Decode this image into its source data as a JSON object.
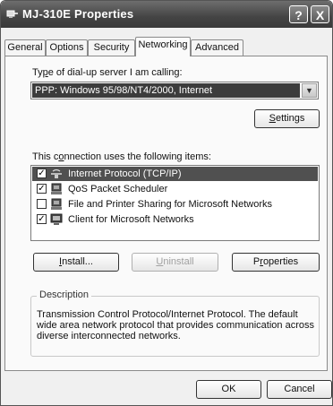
{
  "window": {
    "title": "MJ-310E Properties",
    "help_button": "?",
    "close_button": "X"
  },
  "tabs": [
    {
      "label": "General"
    },
    {
      "label": "Options"
    },
    {
      "label": "Security"
    },
    {
      "label": "Networking",
      "active": true
    },
    {
      "label": "Advanced"
    }
  ],
  "server": {
    "label_prefix": "Ty",
    "label_u": "p",
    "label_rest": "e of dial-up server I am calling:",
    "value": "PPP: Windows 95/98/NT4/2000, Internet"
  },
  "settings_button": {
    "u": "S",
    "rest": "ettings"
  },
  "items_label": {
    "prefix": "This c",
    "u": "o",
    "rest": "nnection uses the following items:"
  },
  "items": [
    {
      "label": "Internet Protocol (TCP/IP)",
      "checked": true,
      "selected": true,
      "icon": "network-protocol-icon"
    },
    {
      "label": "QoS Packet Scheduler",
      "checked": true,
      "selected": false,
      "icon": "network-service-icon"
    },
    {
      "label": "File and Printer Sharing for Microsoft Networks",
      "checked": false,
      "selected": false,
      "icon": "network-service-icon"
    },
    {
      "label": "Client for Microsoft Networks",
      "checked": true,
      "selected": false,
      "icon": "network-client-icon"
    }
  ],
  "checkmark": "✓",
  "buttons": {
    "install": {
      "u": "I",
      "rest": "nstall..."
    },
    "uninstall": {
      "u": "U",
      "rest": "ninstall",
      "disabled": true
    },
    "properties": {
      "prefix": "P",
      "u": "r",
      "rest": "operties"
    }
  },
  "description": {
    "legend": "Description",
    "text": "Transmission Control Protocol/Internet Protocol. The default wide area network protocol that provides communication across diverse interconnected networks."
  },
  "footer": {
    "ok": "OK",
    "cancel": "Cancel"
  },
  "colors": {
    "titlebar": "#444444",
    "selection": "#505050"
  }
}
